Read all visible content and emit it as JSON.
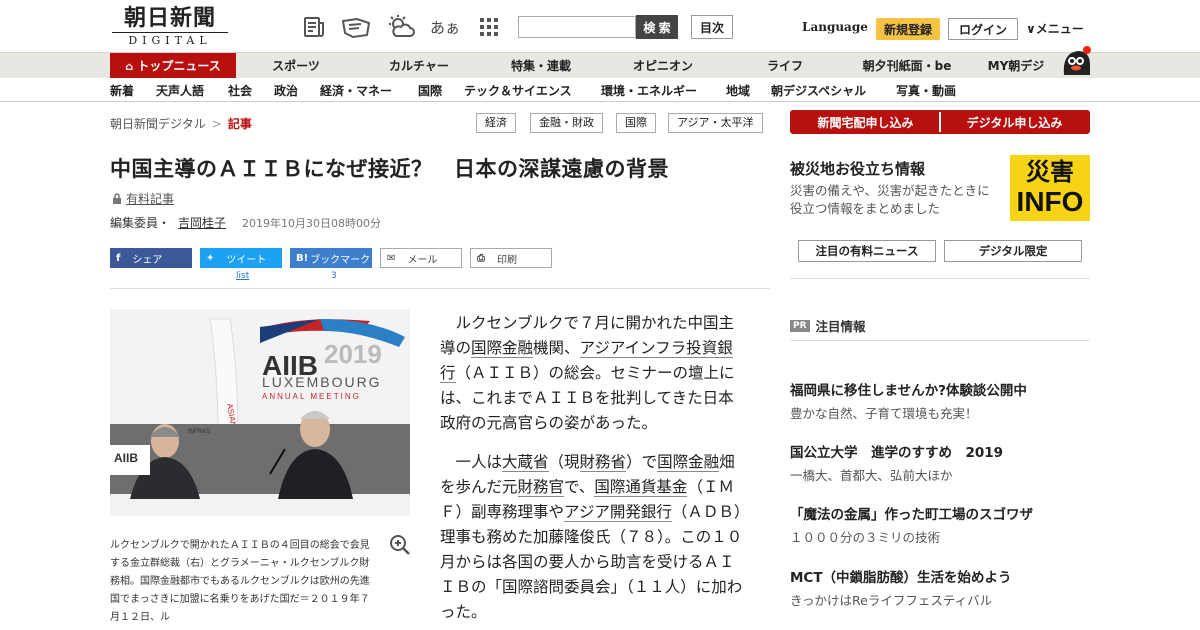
{
  "header": {
    "logo_jp": "朝日新聞",
    "logo_en": "DIGITAL",
    "icons": [
      "newspaper-icon",
      "reading-icon",
      "weather-icon",
      "font-size-icon",
      "apps-grid-icon"
    ],
    "font_icon_text": "あぁ",
    "search_placeholder": "",
    "search_label": "検 索",
    "toc_label": "目次",
    "language_label": "Language",
    "register_label": "新規登録",
    "login_label": "ログイン",
    "menu_label": "∨メニュー"
  },
  "main_nav": [
    "トップニュース",
    "スポーツ",
    "カルチャー",
    "特集・連載",
    "オピニオン",
    "ライフ",
    "朝夕刊紙面・be",
    "MY朝デジ"
  ],
  "sub_nav": [
    "新着",
    "天声人語",
    "社会",
    "政治",
    "経済・マネー",
    "国際",
    "テック＆サイエンス",
    "環境・エネルギー",
    "地域",
    "朝デジスペシャル",
    "写真・動画"
  ],
  "breadcrumb": {
    "home": "朝日新聞デジタル",
    "separator": ">",
    "current": "記事"
  },
  "tags": [
    "経済",
    "金融・財政",
    "国際",
    "アジア・太平洋"
  ],
  "article": {
    "title": "中国主導のＡＩＩＢになぜ接近？　日本の深謀遠慮の背景",
    "paid_label": "有料記事",
    "author_role": "編集委員・",
    "author_name": "吉岡桂子",
    "date": "2019年10月30日08時00分",
    "share": {
      "facebook": "シェア",
      "twitter": "ツイート",
      "hatena": "ブックマーク",
      "mail": "メール",
      "print": "印刷",
      "twitter_count": "list",
      "hatena_count": "3"
    },
    "photo": {
      "banner_big": "AIIB",
      "banner_year": "2019",
      "banner_city": "LUXEMBOURG",
      "banner_sub": "ANNUAL MEETING",
      "podium_logo": "AIIB",
      "screen_text": "INFRAS\nDEVELO\nINVEST"
    },
    "caption": "ルクセンブルクで開かれたＡＩＩＢの４回目の総会で会見する金立群総裁（右）とグラメーニャ・ルクセンブルク財務相。国際金融都市でもあるルクセンブルクは欧州の先進国でまっさきに加盟に名乗りをあげた国だ＝２０１９年７月１２日、ル",
    "para1": {
      "a": "ルクセンブルクで７月に開かれた中国主導の",
      "l1": "国際金融",
      "b": "機関、",
      "l2": "アジアインフラ投資銀行",
      "c": "（ＡＩＩＢ）の総会。セミナーの壇上には、これまでＡＩＩＢを批判してきた日本政府の元高官らの姿があった。"
    },
    "para2": {
      "a": "一人は",
      "l1": "大蔵省",
      "b": "（現",
      "l2": "財務省",
      "c": "）で",
      "l3": "国際金融",
      "d": "畑を歩んだ元",
      "l4": "財務官",
      "e": "で、",
      "l5": "国際通貨基金",
      "f": "（ＩＭＦ）副専務理事や",
      "l6": "アジア開発銀行",
      "g": "（ＡＤＢ）理事も務めた加藤隆俊氏（７８）。この１０月からは各国の要人から助言を受けるＡＩＩＢの「国際諮問委員会」（１１人）に加わった。"
    }
  },
  "sidebar": {
    "apply_newspaper": "新聞宅配申し込み",
    "apply_digital": "デジタル申し込み",
    "disaster_title": "被災地お役立ち情報",
    "disaster_text": "災害の備えや、災害が起きたときに役立つ情報をまとめました",
    "disaster_banner_top": "災害",
    "disaster_banner_bottom": "INFO",
    "btn_paid_news": "注目の有料ニュース",
    "btn_digital_only": "デジタル限定",
    "pr_badge": "PR",
    "pr_heading": "注目情報",
    "pr_items": [
      {
        "title": "福岡県に移住しませんか?体験談公開中",
        "sub": "豊かな自然、子育て環境も充実！"
      },
      {
        "title": "国公立大学　進学のすすめ　2019",
        "sub": "一橋大、首都大、弘前大ほか"
      },
      {
        "title": "「魔法の金属」作った町工場のスゴワザ",
        "sub": "１０００分の３ミリの技術"
      },
      {
        "title": "MCT（中鎖脂肪酸）生活を始めよう",
        "sub": "きっかけはReライフフェスティバル"
      }
    ]
  },
  "colors": {
    "brand_red": "#b8100f",
    "register_yellow": "#f5c342",
    "facebook": "#3b5998",
    "twitter": "#1da1f2",
    "hatena": "#3d7fcc",
    "disaster_yellow": "#f7d316"
  }
}
